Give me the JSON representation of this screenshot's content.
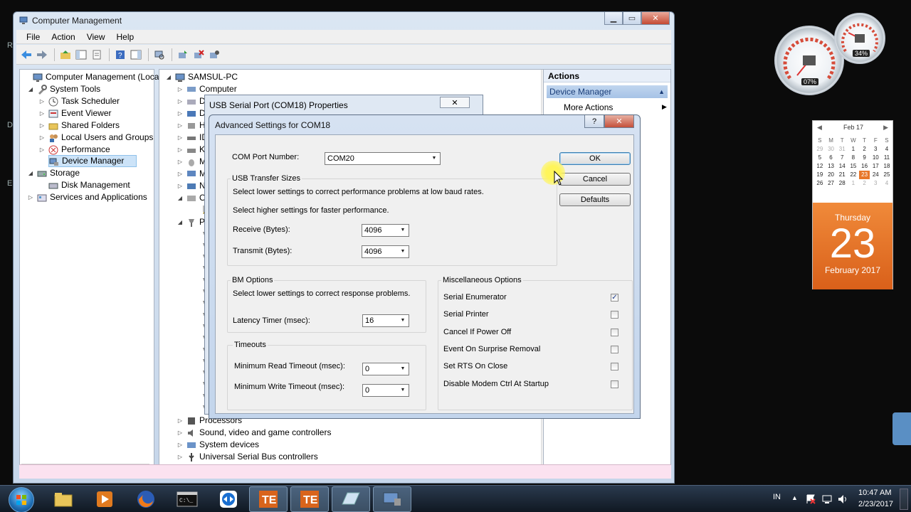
{
  "desktop": {
    "edge_letters": [
      "R",
      "D",
      "E"
    ]
  },
  "main_window": {
    "title": "Computer Management",
    "menu": [
      "File",
      "Action",
      "View",
      "Help"
    ],
    "left_tree": [
      {
        "label": "Computer Management (Local",
        "level": 0
      },
      {
        "label": "System Tools",
        "level": 1
      },
      {
        "label": "Task Scheduler",
        "level": 2
      },
      {
        "label": "Event Viewer",
        "level": 2
      },
      {
        "label": "Shared Folders",
        "level": 2
      },
      {
        "label": "Local Users and Groups",
        "level": 2
      },
      {
        "label": "Performance",
        "level": 2
      },
      {
        "label": "Device Manager",
        "level": 2,
        "selected": true
      },
      {
        "label": "Storage",
        "level": 1
      },
      {
        "label": "Disk Management",
        "level": 2
      },
      {
        "label": "Services and Applications",
        "level": 1
      }
    ],
    "device_tree": {
      "root": "SAMSUL-PC",
      "top_items": [
        "Computer",
        "Disk",
        "Disp",
        "Hum",
        "IDE",
        "Key",
        "Mic",
        "Mon",
        "Net",
        "Othe"
      ],
      "ports_label": "Port",
      "usb_partial": "U",
      "bottom_items": [
        "Processors",
        "Sound, video and game controllers",
        "System devices",
        "Universal Serial Bus controllers"
      ]
    },
    "actions": {
      "header": "Actions",
      "section": "Device Manager",
      "more": "More Actions"
    }
  },
  "properties_dialog": {
    "title": "USB Serial Port (COM18) Properties"
  },
  "advanced_dialog": {
    "title": "Advanced Settings for COM18",
    "help_glyph": "?",
    "com_port_label": "COM Port Number:",
    "com_port_value": "COM20",
    "usb_transfer_caption": "USB Transfer Sizes",
    "usb_line1": "Select lower settings to correct performance problems at low baud rates.",
    "usb_line2": "Select higher settings for faster performance.",
    "receive_label": "Receive (Bytes):",
    "receive_value": "4096",
    "transmit_label": "Transmit (Bytes):",
    "transmit_value": "4096",
    "bm_caption": "BM Options",
    "bm_line": "Select lower settings to correct response problems.",
    "latency_label": "Latency Timer (msec):",
    "latency_value": "16",
    "timeouts_caption": "Timeouts",
    "read_timeout_label": "Minimum Read Timeout (msec):",
    "read_timeout_value": "0",
    "write_timeout_label": "Minimum Write Timeout (msec):",
    "write_timeout_value": "0",
    "misc_caption": "Miscellaneous Options",
    "misc_options": [
      {
        "label": "Serial Enumerator",
        "checked": true
      },
      {
        "label": "Serial Printer",
        "checked": false
      },
      {
        "label": "Cancel If Power Off",
        "checked": false
      },
      {
        "label": "Event On Surprise Removal",
        "checked": false
      },
      {
        "label": "Set RTS On Close",
        "checked": false
      },
      {
        "label": "Disable Modem Ctrl At Startup",
        "checked": false
      }
    ],
    "ok_label": "OK",
    "cancel_label": "Cancel",
    "defaults_label": "Defaults"
  },
  "gadgets": {
    "cpu_pct": "07%",
    "mem_pct": "34%",
    "calendar": {
      "month_short": "Feb 17",
      "dow": [
        "S",
        "M",
        "T",
        "W",
        "T",
        "F",
        "S"
      ],
      "weeks": [
        [
          "29",
          "30",
          "31",
          "1",
          "2",
          "3",
          "4"
        ],
        [
          "5",
          "6",
          "7",
          "8",
          "9",
          "10",
          "11"
        ],
        [
          "12",
          "13",
          "14",
          "15",
          "16",
          "17",
          "18"
        ],
        [
          "19",
          "20",
          "21",
          "22",
          "23",
          "24",
          "25"
        ],
        [
          "26",
          "27",
          "28",
          "1",
          "2",
          "3",
          "4"
        ]
      ],
      "today": "23",
      "weekday": "Thursday",
      "day": "23",
      "month_year": "February 2017"
    }
  },
  "taskbar": {
    "language": "IN",
    "time": "10:47 AM",
    "date": "2/23/2017"
  },
  "colors": {
    "accent": "#e8772a",
    "selection": "#cce3f8"
  }
}
